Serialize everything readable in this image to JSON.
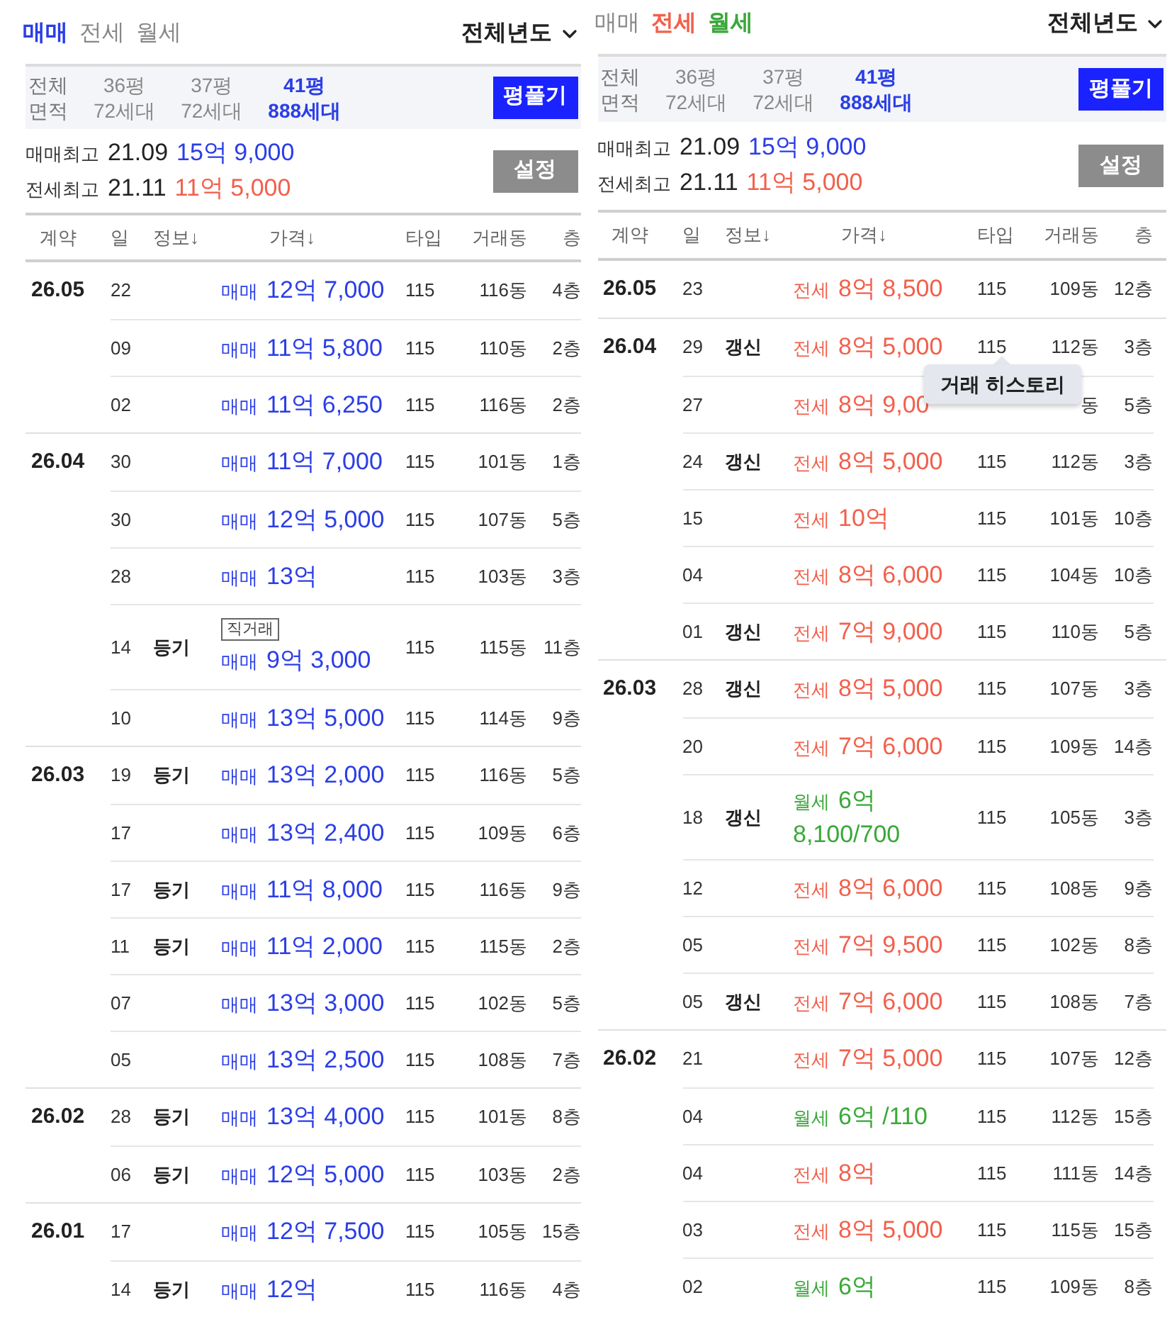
{
  "panels": [
    {
      "tabs": [
        {
          "label": "매매",
          "kind": "sale",
          "selected": true
        },
        {
          "label": "전세",
          "selected": false
        },
        {
          "label": "월세",
          "selected": false
        }
      ],
      "year_filter": "전체년도",
      "area_filter": {
        "title": "전체",
        "subtitle": "면적",
        "options": [
          {
            "size": "36평",
            "count": "72세대",
            "selected": false
          },
          {
            "size": "37평",
            "count": "72세대",
            "selected": false
          },
          {
            "size": "41평",
            "count": "888세대",
            "selected": true
          }
        ],
        "button": "평풀기"
      },
      "highs": [
        {
          "label": "매매최고",
          "date": "21.09",
          "price": "15억 9,000",
          "kind": "sale"
        },
        {
          "label": "전세최고",
          "date": "21.11",
          "price": "11억 5,000",
          "kind": "jeonse"
        }
      ],
      "settings_button": "설정",
      "columns": [
        "계약",
        "일",
        "정보↓",
        "가격↓",
        "타입",
        "거래동",
        "층"
      ],
      "groups": [
        {
          "month": "26.05",
          "rows": [
            {
              "day": "22",
              "deal": "매매",
              "kind": "sale",
              "price": "12억 7,000",
              "type": "115",
              "dong": "116동",
              "floor": "4층"
            },
            {
              "day": "09",
              "deal": "매매",
              "kind": "sale",
              "price": "11억 5,800",
              "type": "115",
              "dong": "110동",
              "floor": "2층"
            },
            {
              "day": "02",
              "deal": "매매",
              "kind": "sale",
              "price": "11억 6,250",
              "type": "115",
              "dong": "116동",
              "floor": "2층"
            }
          ]
        },
        {
          "month": "26.04",
          "rows": [
            {
              "day": "30",
              "deal": "매매",
              "kind": "sale",
              "price": "11억 7,000",
              "type": "115",
              "dong": "101동",
              "floor": "1층"
            },
            {
              "day": "30",
              "deal": "매매",
              "kind": "sale",
              "price": "12억 5,000",
              "type": "115",
              "dong": "107동",
              "floor": "5층"
            },
            {
              "day": "28",
              "deal": "매매",
              "kind": "sale",
              "price": "13억",
              "type": "115",
              "dong": "103동",
              "floor": "3층"
            },
            {
              "day": "14",
              "info": "등기",
              "badge": "직거래",
              "deal": "매매",
              "kind": "sale",
              "price": "9억 3,000",
              "type": "115",
              "dong": "115동",
              "floor": "11층"
            },
            {
              "day": "10",
              "deal": "매매",
              "kind": "sale",
              "price": "13억 5,000",
              "type": "115",
              "dong": "114동",
              "floor": "9층"
            }
          ]
        },
        {
          "month": "26.03",
          "rows": [
            {
              "day": "19",
              "info": "등기",
              "deal": "매매",
              "kind": "sale",
              "price": "13억 2,000",
              "type": "115",
              "dong": "116동",
              "floor": "5층"
            },
            {
              "day": "17",
              "deal": "매매",
              "kind": "sale",
              "price": "13억 2,400",
              "type": "115",
              "dong": "109동",
              "floor": "6층"
            },
            {
              "day": "17",
              "info": "등기",
              "deal": "매매",
              "kind": "sale",
              "price": "11억 8,000",
              "type": "115",
              "dong": "116동",
              "floor": "9층"
            },
            {
              "day": "11",
              "info": "등기",
              "deal": "매매",
              "kind": "sale",
              "price": "11억 2,000",
              "type": "115",
              "dong": "115동",
              "floor": "2층"
            },
            {
              "day": "07",
              "deal": "매매",
              "kind": "sale",
              "price": "13억 3,000",
              "type": "115",
              "dong": "102동",
              "floor": "5층"
            },
            {
              "day": "05",
              "deal": "매매",
              "kind": "sale",
              "price": "13억 2,500",
              "type": "115",
              "dong": "108동",
              "floor": "7층"
            }
          ]
        },
        {
          "month": "26.02",
          "rows": [
            {
              "day": "28",
              "info": "등기",
              "deal": "매매",
              "kind": "sale",
              "price": "13억 4,000",
              "type": "115",
              "dong": "101동",
              "floor": "8층"
            },
            {
              "day": "06",
              "info": "등기",
              "deal": "매매",
              "kind": "sale",
              "price": "12억 5,000",
              "type": "115",
              "dong": "103동",
              "floor": "2층"
            }
          ]
        },
        {
          "month": "26.01",
          "rows": [
            {
              "day": "17",
              "deal": "매매",
              "kind": "sale",
              "price": "12억 7,500",
              "type": "115",
              "dong": "105동",
              "floor": "15층"
            },
            {
              "day": "14",
              "info": "등기",
              "deal": "매매",
              "kind": "sale",
              "price": "12억",
              "type": "115",
              "dong": "116동",
              "floor": "4층"
            }
          ]
        }
      ]
    },
    {
      "tabs": [
        {
          "label": "매매",
          "selected": false
        },
        {
          "label": "전세",
          "kind": "jeonse",
          "selected": true
        },
        {
          "label": "월세",
          "kind": "monthly",
          "selected": true
        }
      ],
      "year_filter": "전체년도",
      "area_filter": {
        "title": "전체",
        "subtitle": "면적",
        "options": [
          {
            "size": "36평",
            "count": "72세대",
            "selected": false
          },
          {
            "size": "37평",
            "count": "72세대",
            "selected": false
          },
          {
            "size": "41평",
            "count": "888세대",
            "selected": true
          }
        ],
        "button": "평풀기"
      },
      "highs": [
        {
          "label": "매매최고",
          "date": "21.09",
          "price": "15억 9,000",
          "kind": "sale"
        },
        {
          "label": "전세최고",
          "date": "21.11",
          "price": "11억 5,000",
          "kind": "jeonse"
        }
      ],
      "settings_button": "설정",
      "columns": [
        "계약",
        "일",
        "정보↓",
        "가격↓",
        "타입",
        "거래동",
        "층"
      ],
      "groups": [
        {
          "month": "26.05",
          "rows": [
            {
              "day": "23",
              "deal": "전세",
              "kind": "jeonse",
              "price": "8억 8,500",
              "type": "115",
              "dong": "109동",
              "floor": "12층"
            }
          ]
        },
        {
          "month": "26.04",
          "rows": [
            {
              "day": "29",
              "info": "갱신",
              "deal": "전세",
              "kind": "jeonse",
              "price": "8억 5,000",
              "type": "115",
              "dong": "112동",
              "floor": "3층",
              "tooltip": "거래 히스토리"
            },
            {
              "day": "27",
              "deal": "전세",
              "kind": "jeonse",
              "price": "8억 9,00",
              "dong": "동",
              "floor": "5층"
            },
            {
              "day": "24",
              "info": "갱신",
              "deal": "전세",
              "kind": "jeonse",
              "price": "8억 5,000",
              "type": "115",
              "dong": "112동",
              "floor": "3층"
            },
            {
              "day": "15",
              "deal": "전세",
              "kind": "jeonse",
              "price": "10억",
              "type": "115",
              "dong": "101동",
              "floor": "10층"
            },
            {
              "day": "04",
              "deal": "전세",
              "kind": "jeonse",
              "price": "8억 6,000",
              "type": "115",
              "dong": "104동",
              "floor": "10층"
            },
            {
              "day": "01",
              "info": "갱신",
              "deal": "전세",
              "kind": "jeonse",
              "price": "7억 9,000",
              "type": "115",
              "dong": "110동",
              "floor": "5층"
            }
          ]
        },
        {
          "month": "26.03",
          "rows": [
            {
              "day": "28",
              "info": "갱신",
              "deal": "전세",
              "kind": "jeonse",
              "price": "8억 5,000",
              "type": "115",
              "dong": "107동",
              "floor": "3층"
            },
            {
              "day": "20",
              "deal": "전세",
              "kind": "jeonse",
              "price": "7억 6,000",
              "type": "115",
              "dong": "109동",
              "floor": "14층"
            },
            {
              "day": "18",
              "info": "갱신",
              "deal": "월세",
              "kind": "monthly",
              "price": "6억",
              "price_2": "8,100/700",
              "type": "115",
              "dong": "105동",
              "floor": "3층"
            },
            {
              "day": "12",
              "deal": "전세",
              "kind": "jeonse",
              "price": "8억 6,000",
              "type": "115",
              "dong": "108동",
              "floor": "9층"
            },
            {
              "day": "05",
              "deal": "전세",
              "kind": "jeonse",
              "price": "7억 9,500",
              "type": "115",
              "dong": "102동",
              "floor": "8층"
            },
            {
              "day": "05",
              "info": "갱신",
              "deal": "전세",
              "kind": "jeonse",
              "price": "7억 6,000",
              "type": "115",
              "dong": "108동",
              "floor": "7층"
            }
          ]
        },
        {
          "month": "26.02",
          "rows": [
            {
              "day": "21",
              "deal": "전세",
              "kind": "jeonse",
              "price": "7억 5,000",
              "type": "115",
              "dong": "107동",
              "floor": "12층"
            },
            {
              "day": "04",
              "deal": "월세",
              "kind": "monthly",
              "price": "6억 /110",
              "type": "115",
              "dong": "112동",
              "floor": "15층"
            },
            {
              "day": "04",
              "deal": "전세",
              "kind": "jeonse",
              "price": "8억",
              "type": "115",
              "dong": "111동",
              "floor": "14층"
            },
            {
              "day": "03",
              "deal": "전세",
              "kind": "jeonse",
              "price": "8억 5,000",
              "type": "115",
              "dong": "115동",
              "floor": "15층"
            },
            {
              "day": "02",
              "deal": "월세",
              "kind": "monthly",
              "price": "6억",
              "type": "115",
              "dong": "109동",
              "floor": "8층"
            }
          ]
        }
      ]
    }
  ]
}
